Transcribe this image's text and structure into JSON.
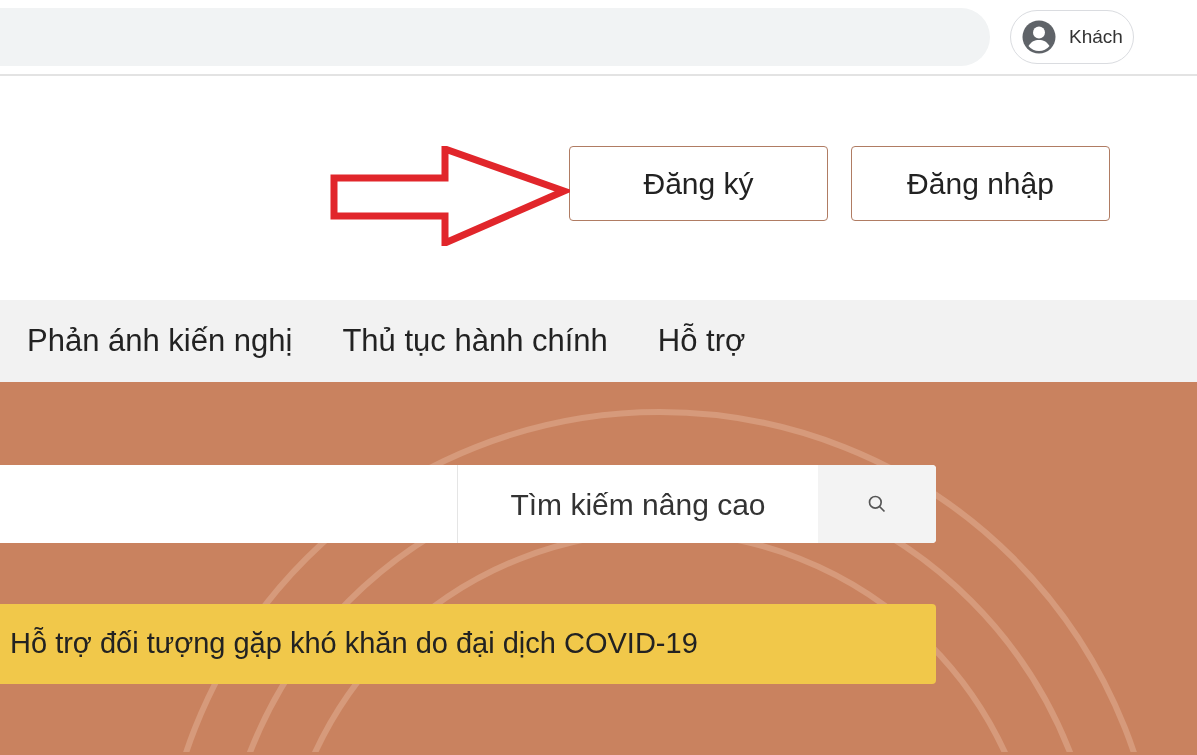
{
  "browser": {
    "profile_label": "Khách"
  },
  "auth_buttons": [
    {
      "label": "Đăng ký"
    },
    {
      "label": "Đăng nhập"
    }
  ],
  "nav": {
    "items": [
      {
        "label": "Phản ánh kiến nghị"
      },
      {
        "label": "Thủ tục hành chính"
      },
      {
        "label": "Hỗ trợ"
      }
    ]
  },
  "search": {
    "advanced_label": "Tìm kiếm nâng cao"
  },
  "notice": {
    "text": "Hỗ trợ đối tượng gặp khó khăn do đại dịch COVID-19"
  }
}
